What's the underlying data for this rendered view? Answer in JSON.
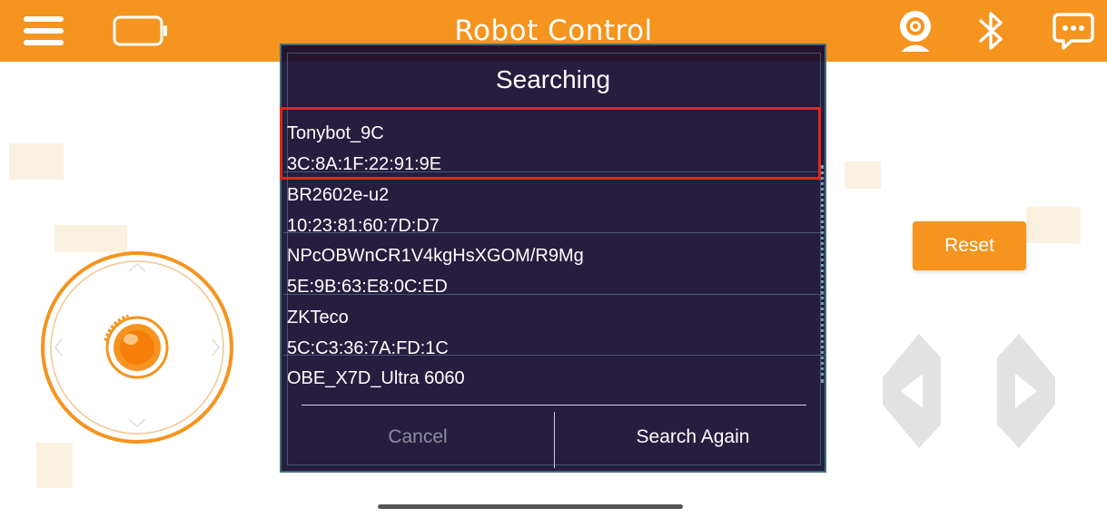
{
  "header": {
    "title": "Robot Control",
    "accent": "#F5941E"
  },
  "icons": {
    "menu": "menu-icon",
    "battery": "battery-icon",
    "camera": "webcam-icon",
    "bluetooth": "bluetooth-icon",
    "chat": "chat-icon"
  },
  "controls": {
    "reset_label": "Reset"
  },
  "dialog": {
    "title": "Searching",
    "devices": [
      {
        "name": "Tonybot_9C",
        "mac": "3C:8A:1F:22:91:9E",
        "highlighted": true
      },
      {
        "name": "BR2602e-u2",
        "mac": "10:23:81:60:7D:D7",
        "highlighted": false
      },
      {
        "name": "NPcOBWnCR1V4kgHsXGOM/R9Mg",
        "mac": "5E:9B:63:E8:0C:ED",
        "highlighted": false
      },
      {
        "name": "ZKTeco",
        "mac": "5C:C3:36:7A:FD:1C",
        "highlighted": false
      },
      {
        "name": "OBE_X7D_Ultra 6060",
        "mac": "",
        "highlighted": false
      }
    ],
    "cancel_label": "Cancel",
    "search_again_label": "Search Again",
    "highlight_color": "#E0281A"
  }
}
